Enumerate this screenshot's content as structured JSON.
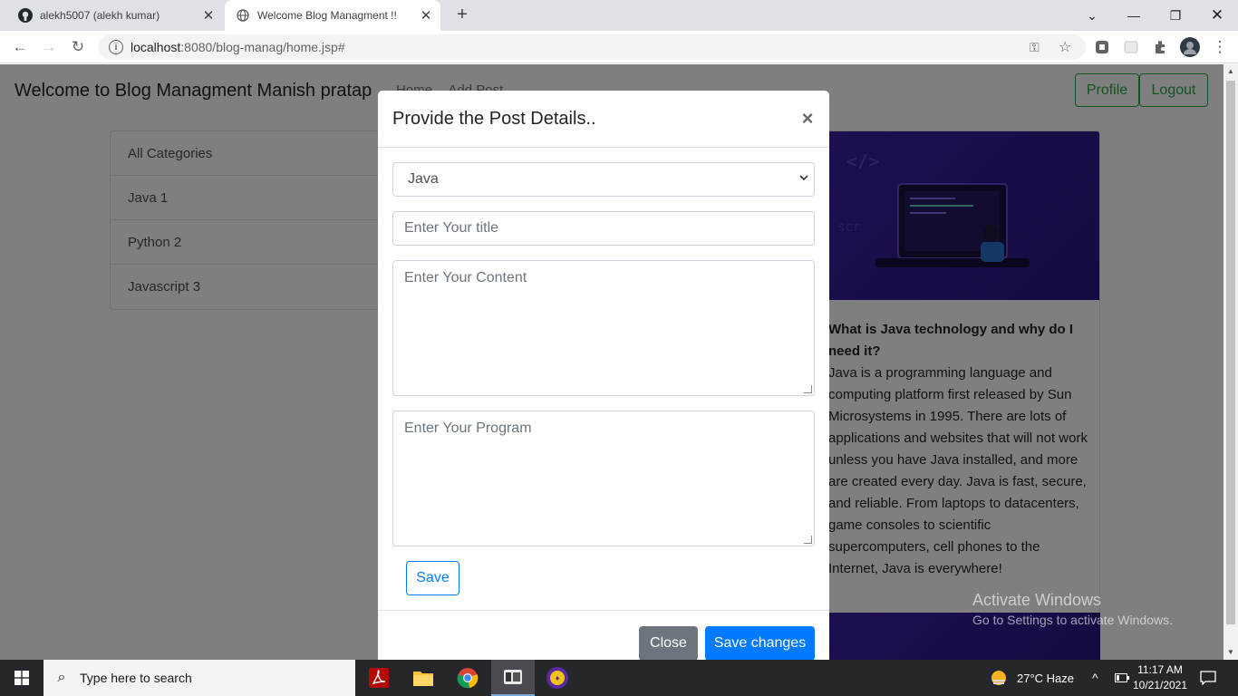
{
  "browser": {
    "tabs": [
      {
        "title": "alekh5007 (alekh kumar)"
      },
      {
        "title": "Welcome Blog Managment !!"
      }
    ],
    "url_host": "localhost",
    "url_path": ":8080/blog-manag/home.jsp#"
  },
  "navbar": {
    "brand": "Welcome to Blog Managment Manish pratap",
    "links": [
      "Home",
      "Add Post"
    ],
    "profile_label": "Profile",
    "logout_label": "Logout"
  },
  "categories": [
    {
      "label": "All Categories"
    },
    {
      "label": "Java 1"
    },
    {
      "label": "Python 2"
    },
    {
      "label": "Javascript 3"
    }
  ],
  "post_card": {
    "title": "What is Java technology and why do I need it?",
    "text": "Java is a programming language and computing platform first released by Sun Microsystems in 1995. There are lots of applications and websites that will not work unless you have Java installed, and more are created every day. Java is fast, secure, and reliable. From laptops to datacenters, game consoles to scientific supercomputers, cell phones to the Internet, Java is everywhere!"
  },
  "modal": {
    "title": "Provide the Post Details..",
    "category_selected": "Java",
    "title_placeholder": "Enter Your title",
    "content_placeholder": "Enter Your Content",
    "program_placeholder": "Enter Your Program",
    "save_label": "Save",
    "close_label": "Close",
    "save_changes_label": "Save changes"
  },
  "watermark": {
    "line1": "Activate Windows",
    "line2": "Go to Settings to activate Windows."
  },
  "taskbar": {
    "search_placeholder": "Type here to search",
    "weather": "27°C  Haze",
    "time": "11:17 AM",
    "date": "10/21/2021"
  },
  "colors": {
    "primary": "#007bff",
    "secondary": "#6c757d",
    "success": "#28a745"
  }
}
